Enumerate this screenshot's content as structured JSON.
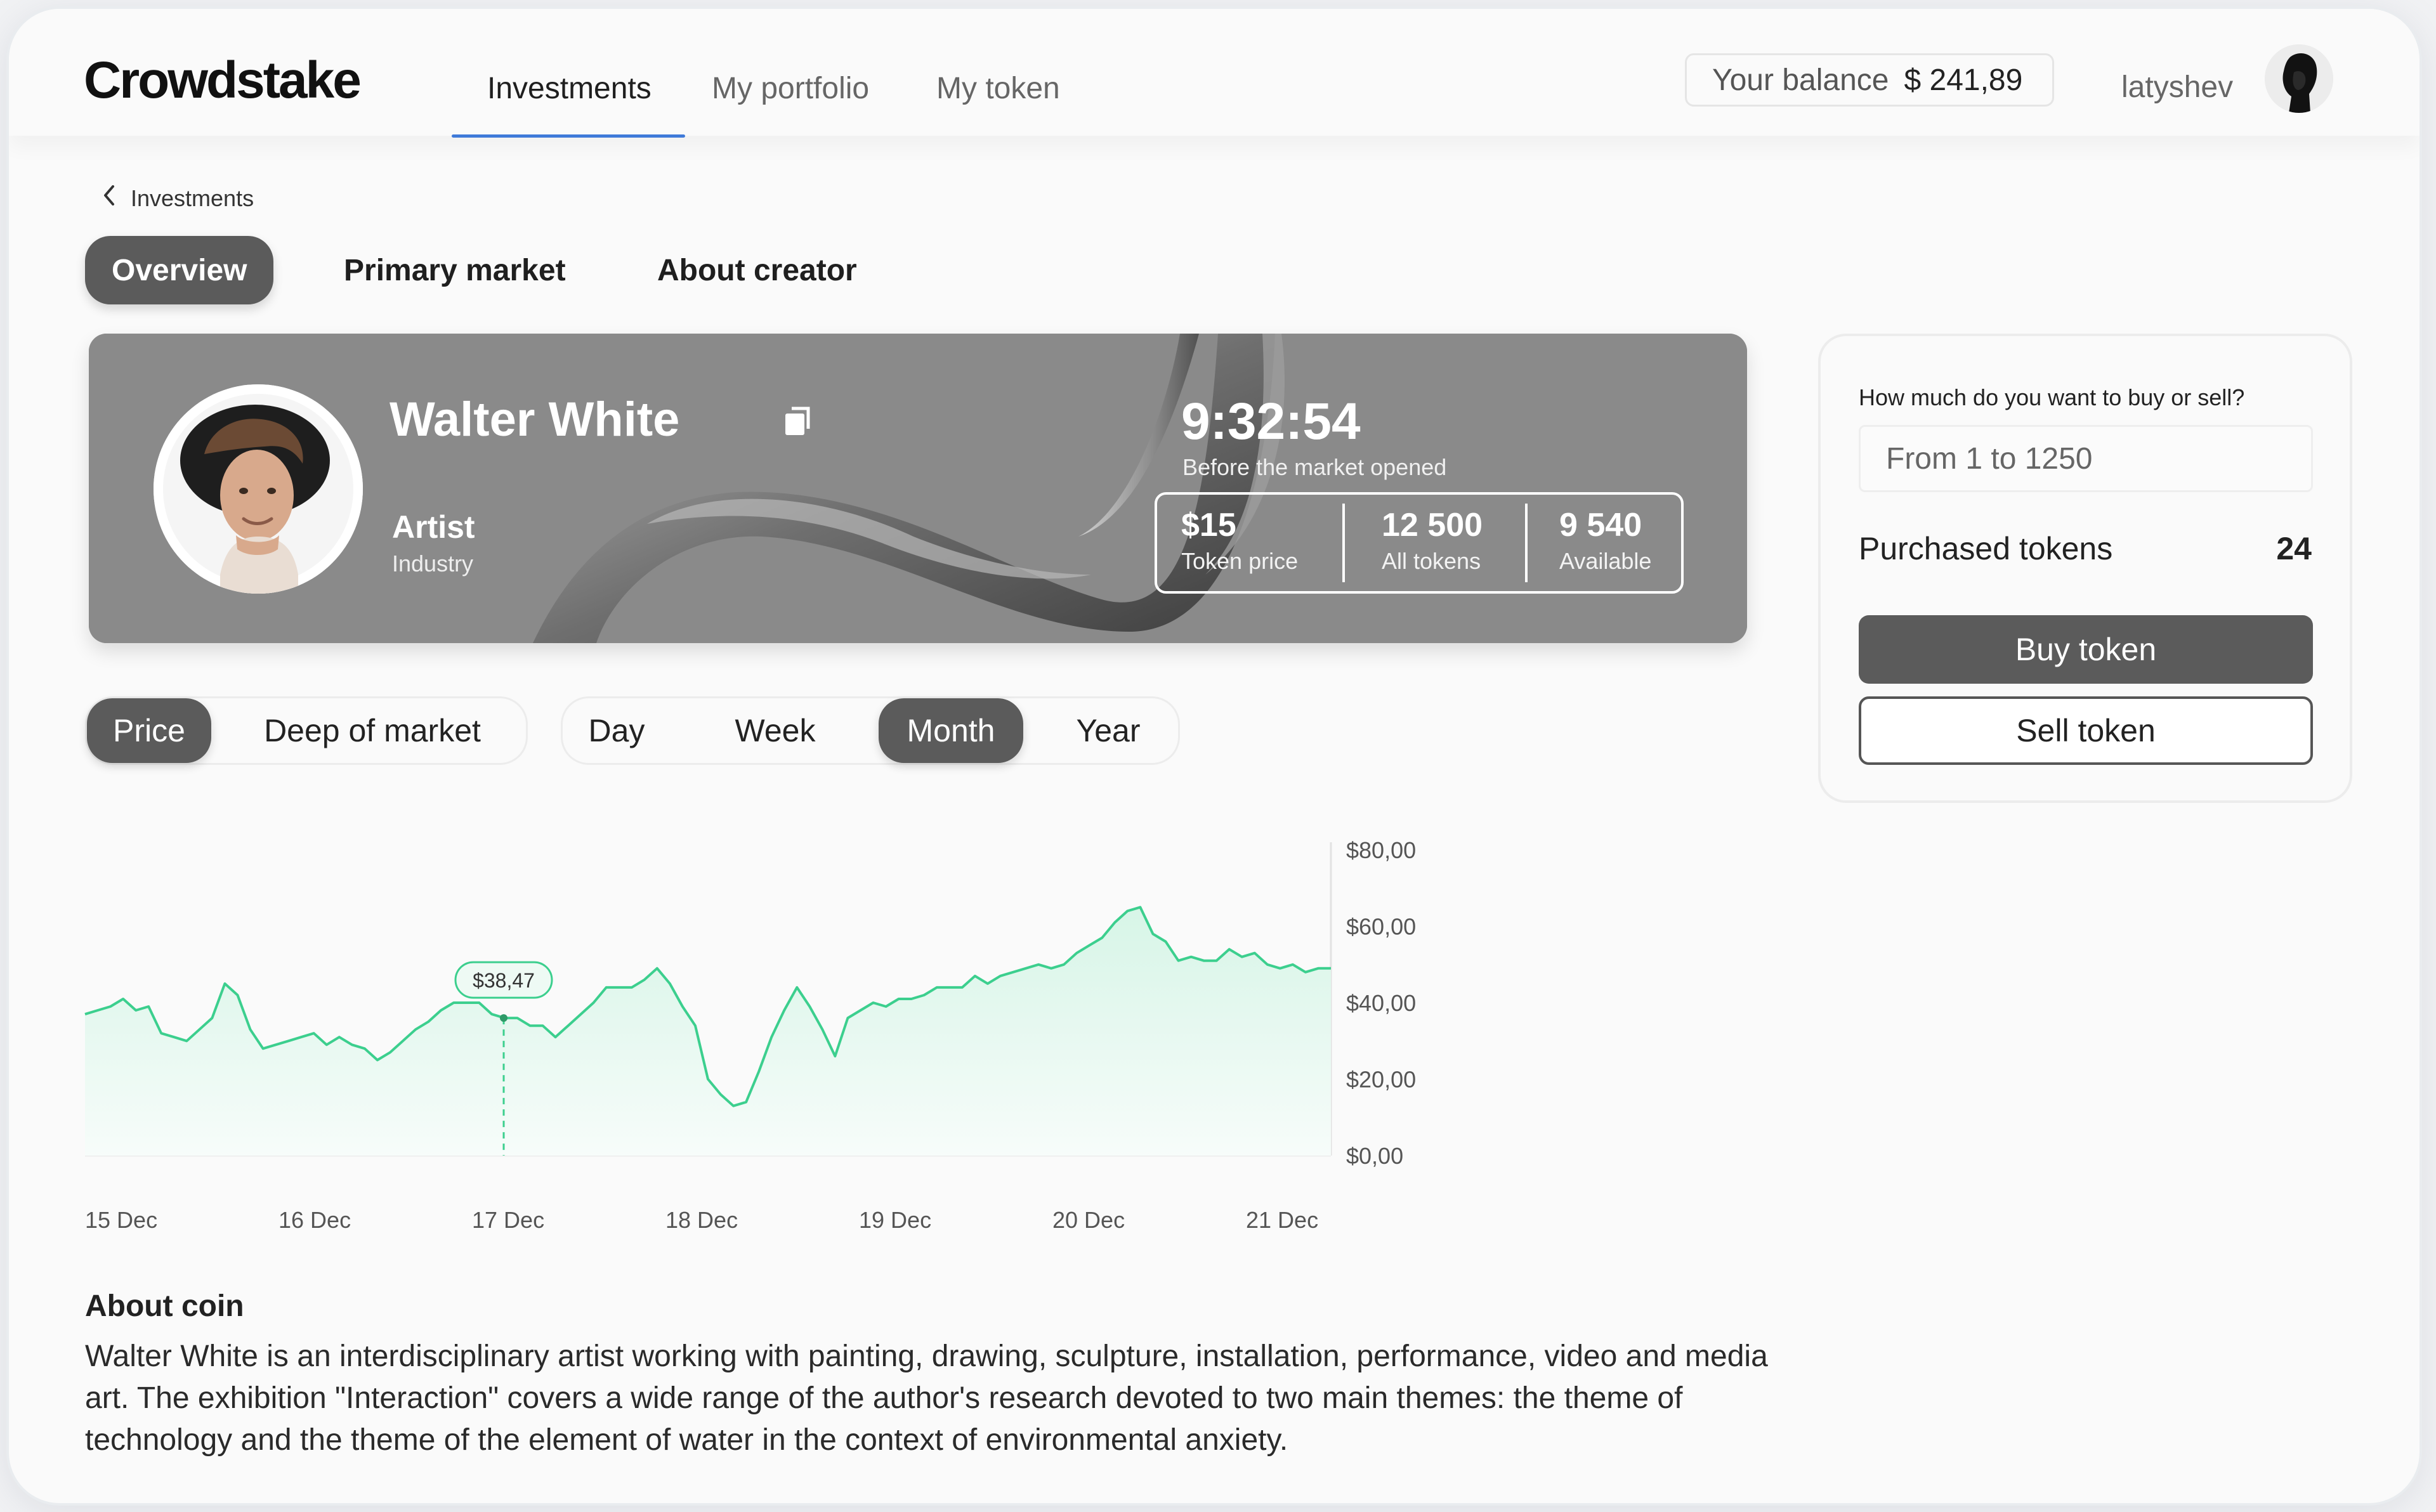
{
  "app": {
    "logo": "Crowdstake",
    "nav": [
      "Investments",
      "My portfolio",
      "My token"
    ],
    "balance_label": "Your balance",
    "balance_value": "$ 241,89",
    "username": "latyshev"
  },
  "breadcrumb": "Investments",
  "page_tabs": [
    "Overview",
    "Primary market",
    "About creator"
  ],
  "hero": {
    "name": "Walter White",
    "role": "Artist",
    "role_sub": "Industry",
    "timer": "9:32:54",
    "timer_sub": "Before the market opened",
    "stats": [
      {
        "value": "$15",
        "label": "Token price"
      },
      {
        "value": "12 500",
        "label": "All tokens"
      },
      {
        "value": "9 540",
        "label": "Available"
      }
    ]
  },
  "chart_toggle": [
    "Price",
    "Deep of market"
  ],
  "period_toggle": [
    "Day",
    "Week",
    "Month",
    "Year"
  ],
  "chart_data": {
    "type": "area",
    "x_ticks": [
      "15 Dec",
      "16 Dec",
      "17 Dec",
      "18 Dec",
      "19 Dec",
      "20 Dec",
      "21 Dec"
    ],
    "y_ticks": [
      "$80,00",
      "$60,00",
      "$40,00",
      "$20,00",
      "$0,00"
    ],
    "ylim": [
      0,
      80
    ],
    "series": [
      {
        "values": [
          37,
          38,
          39,
          41,
          38,
          39,
          32,
          31,
          30,
          33,
          36,
          45,
          42,
          33,
          28,
          29,
          30,
          31,
          32,
          29,
          31,
          29,
          28,
          25,
          27,
          30,
          33,
          35,
          38,
          40,
          40,
          40,
          37,
          36,
          36,
          34,
          34,
          31,
          34,
          37,
          40,
          44,
          44,
          44,
          46,
          49,
          45,
          39,
          34,
          20,
          16,
          13,
          14,
          22,
          31,
          38,
          44,
          39,
          33,
          26,
          36,
          38,
          40,
          39,
          41,
          41,
          42,
          44,
          44,
          44,
          47,
          45,
          47,
          48,
          49,
          50,
          49,
          50,
          53,
          55,
          57,
          61,
          64,
          65,
          58,
          56,
          51,
          52,
          51,
          51,
          54,
          52,
          53,
          50,
          49,
          50,
          48,
          49,
          49
        ]
      }
    ],
    "highlight": {
      "x_label": "17 Dec",
      "value": "$38,47"
    },
    "colors": {
      "line": "#3ccf8e",
      "fill_top": "#d7f5e7",
      "fill_bottom": "#f7fcfa"
    }
  },
  "about": {
    "title": "About coin",
    "text": "Walter White is an interdisciplinary artist working with painting, drawing, sculpture, installation, performance, video and media art. The exhibition \"Interaction\" covers a wide range of the author's research devoted to two main themes: the theme of technology and the theme of the element of water in the context of environmental anxiety."
  },
  "trade_panel": {
    "question": "How much do you want to buy or sell?",
    "input_placeholder": "From 1 to 1250",
    "purchased_label": "Purchased tokens",
    "purchased_value": "24",
    "buy_label": "Buy token",
    "sell_label": "Sell token"
  },
  "colors": {
    "accent_underline": "#3f7ad9",
    "active_dark": "#5b5b5b",
    "hero_bg": "#8a8a8a"
  },
  "icons": [
    "chevron-left-icon",
    "copy-icon"
  ]
}
